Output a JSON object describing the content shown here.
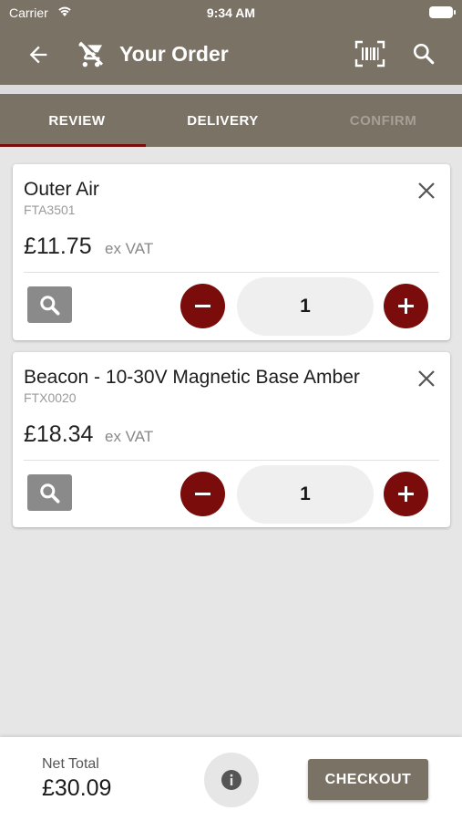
{
  "status_bar": {
    "carrier": "Carrier",
    "time": "9:34 AM"
  },
  "app_bar": {
    "title": "Your Order",
    "icons": [
      "back-arrow-icon",
      "cart-off-icon",
      "barcode-scan-icon",
      "search-icon"
    ]
  },
  "tabs": [
    {
      "label": "REVIEW",
      "active": true
    },
    {
      "label": "DELIVERY",
      "active": false
    },
    {
      "label": "CONFIRM",
      "active": false,
      "disabled": true
    }
  ],
  "items": [
    {
      "name": "Outer Air",
      "code": "FTA3501",
      "price": "£11.75",
      "vat_label": "ex VAT",
      "quantity": "1"
    },
    {
      "name": "Beacon - 10-30V Magnetic Base Amber",
      "code": "FTX0020",
      "price": "£18.34",
      "vat_label": "ex VAT",
      "quantity": "1"
    }
  ],
  "footer": {
    "net_total_label": "Net Total",
    "net_total": "£30.09",
    "checkout_label": "CHECKOUT"
  },
  "colors": {
    "primary": "#7b7266",
    "accent": "#7a0c0c",
    "background": "#e6e6e6"
  }
}
